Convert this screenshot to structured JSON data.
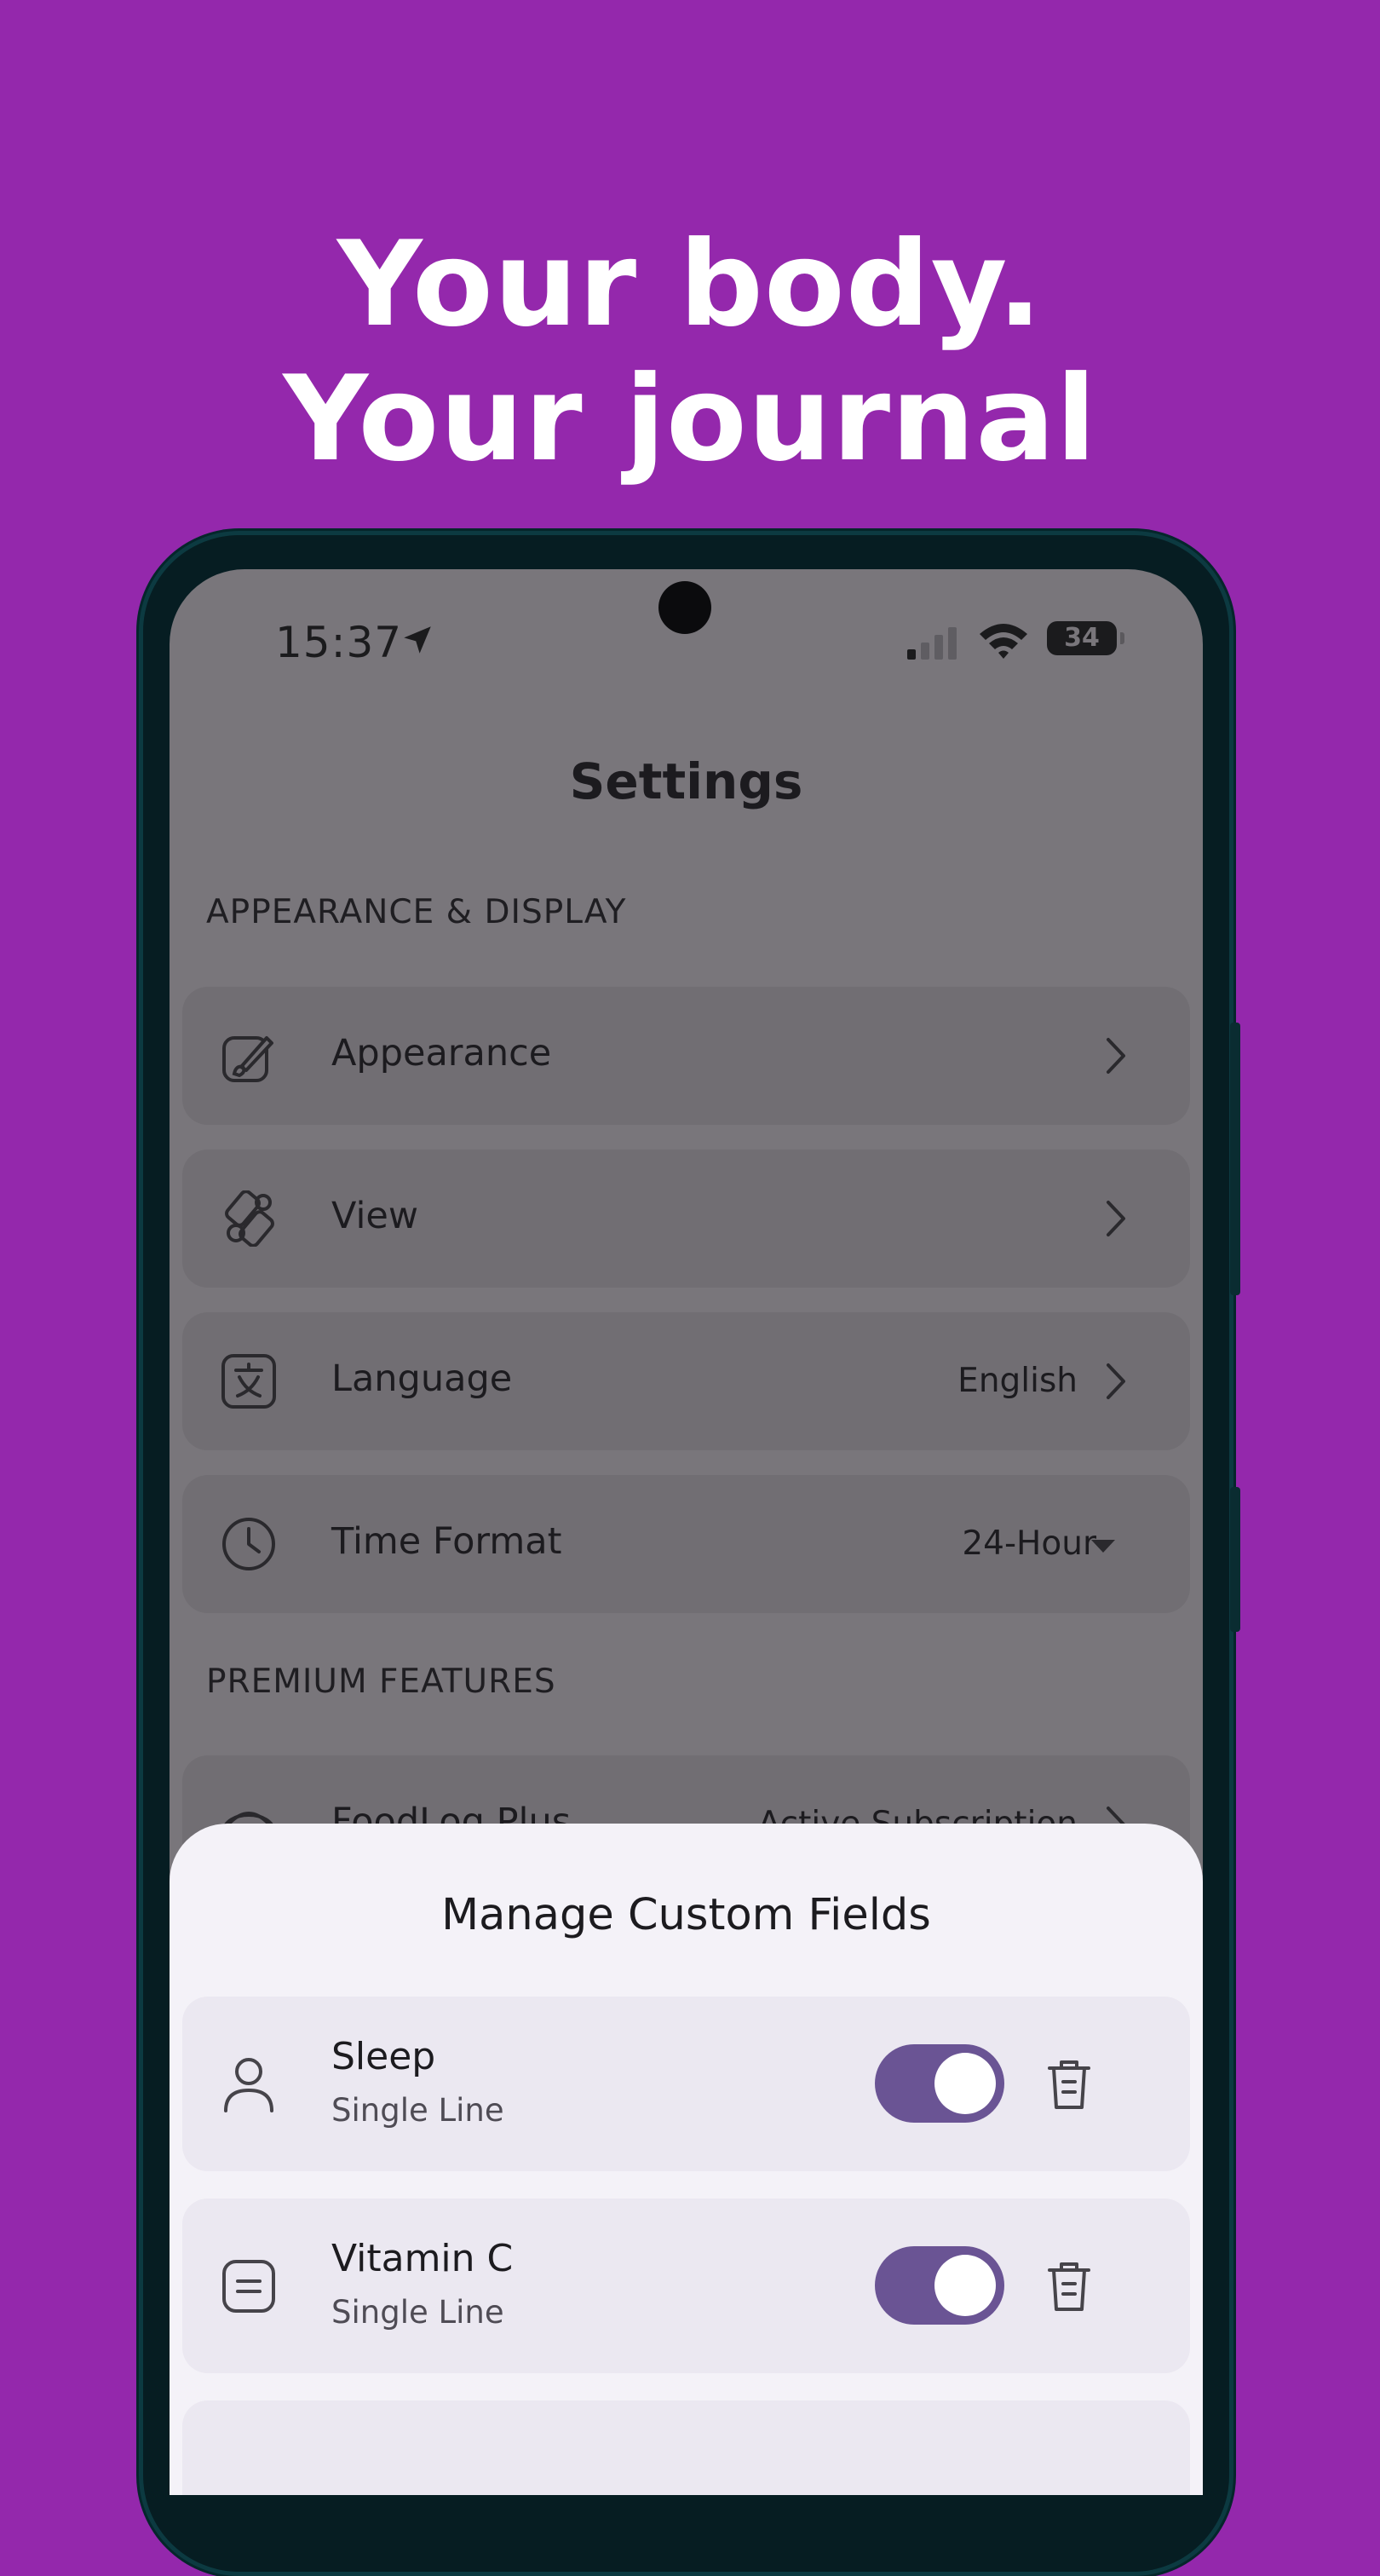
{
  "promo": {
    "headline_line1": "Your body.",
    "headline_line2": "Your journal"
  },
  "colors": {
    "background": "#9428ac",
    "toggle_on": "#6a5494",
    "sheet": "#f4f2f8",
    "dim_overlay": "#79767b"
  },
  "status_bar": {
    "time": "15:37",
    "battery": "34",
    "icons": [
      "location-arrow-icon",
      "signal-icon",
      "wifi-icon",
      "battery-icon"
    ]
  },
  "settings": {
    "title": "Settings",
    "sections": [
      {
        "label": "APPEARANCE & DISPLAY",
        "items": [
          {
            "icon": "paintbrush-icon",
            "label": "Appearance",
            "value": "",
            "control": "chevron"
          },
          {
            "icon": "view-icon",
            "label": "View",
            "value": "",
            "control": "chevron"
          },
          {
            "icon": "translate-icon",
            "label": "Language",
            "value": "English",
            "control": "chevron"
          },
          {
            "icon": "clock-icon",
            "label": "Time Format",
            "value": "24-Hour",
            "control": "dropdown"
          }
        ]
      },
      {
        "label": "PREMIUM FEATURES",
        "items": [
          {
            "icon": "foodlog-icon",
            "label": "FoodLog Plus",
            "value": "Active Subscription",
            "control": "chevron"
          }
        ]
      }
    ]
  },
  "sheet": {
    "title": "Manage Custom Fields",
    "fields": [
      {
        "icon": "person-icon",
        "name": "Sleep",
        "type": "Single Line",
        "enabled": true
      },
      {
        "icon": "text-field-icon",
        "name": "Vitamin C",
        "type": "Single Line",
        "enabled": true
      }
    ]
  }
}
